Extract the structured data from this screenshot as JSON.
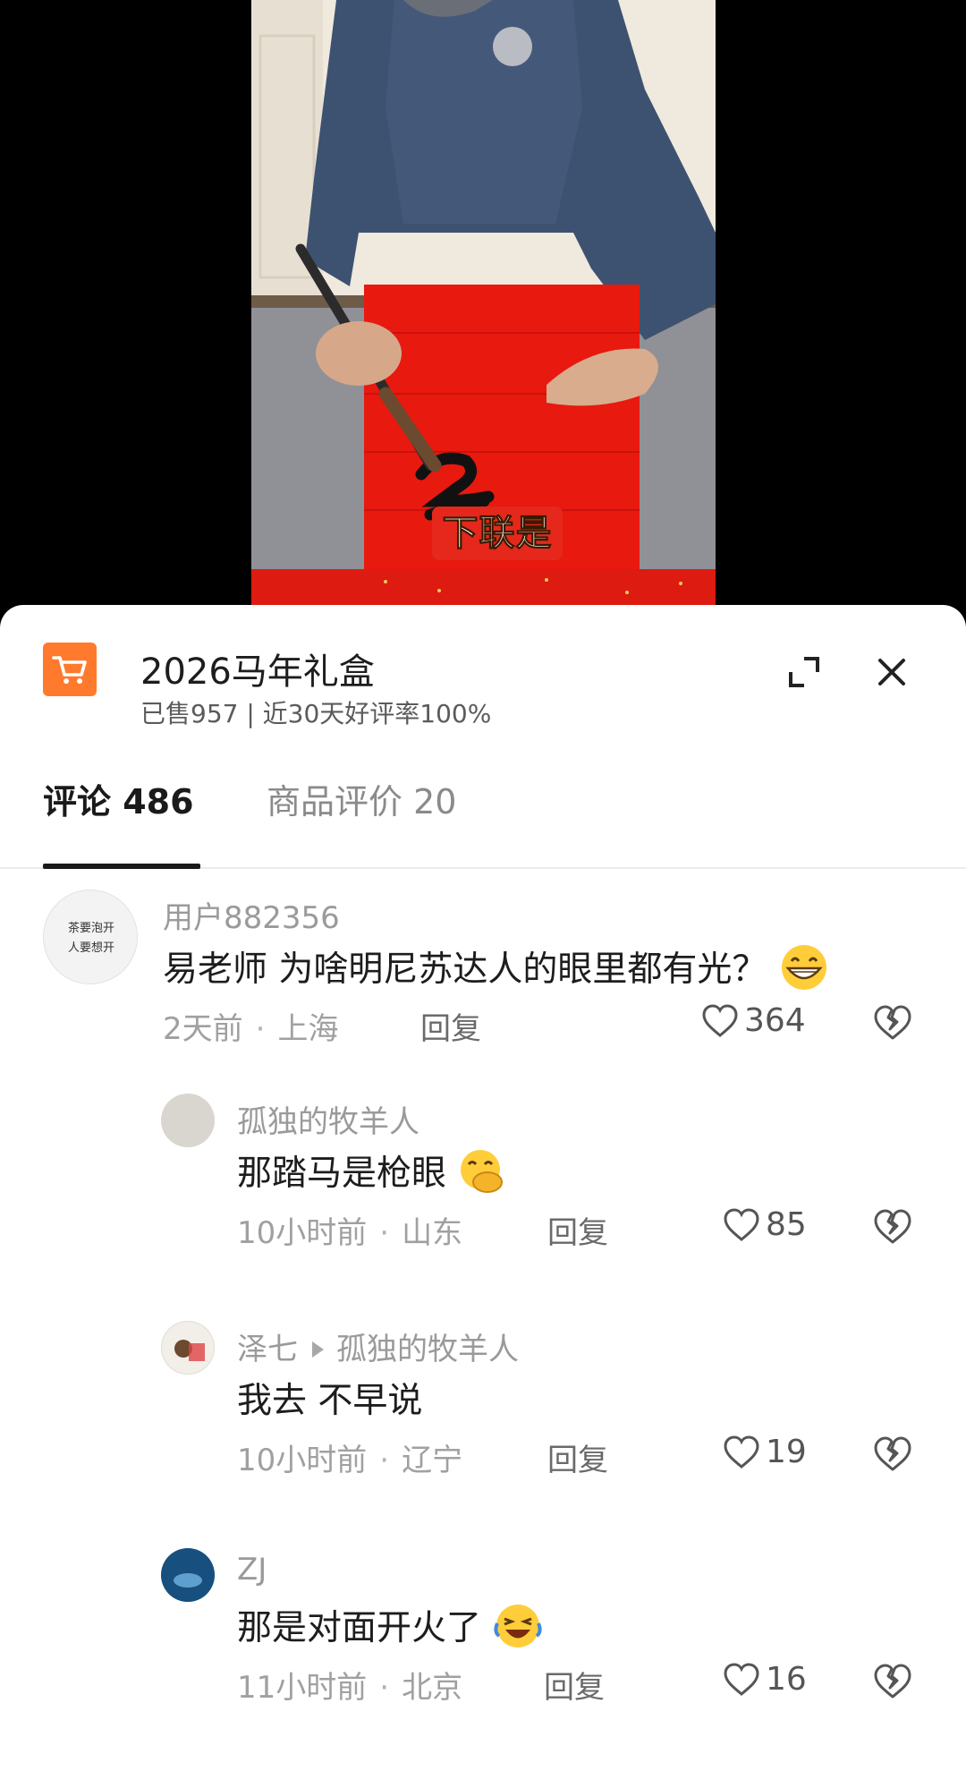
{
  "video": {
    "caption": "下联是"
  },
  "product": {
    "title": "2026马年礼盒",
    "subtitle": "已售957 | 近30天好评率100%",
    "icon": "shopping-cart-icon",
    "accent": "#ff7a2c"
  },
  "tabs": [
    {
      "label": "评论 486",
      "active": true
    },
    {
      "label": "商品评价 20",
      "active": false
    }
  ],
  "comments": [
    {
      "user": "用户882356",
      "avatar_text": [
        "茶要泡开",
        "人要想开"
      ],
      "text": "易老师 为啥明尼苏达人的眼里都有光？",
      "emoji": "grin-emoji",
      "time": "2天前",
      "location": "上海",
      "reply_label": "回复",
      "likes": "364"
    },
    {
      "user": "孤独的牧羊人",
      "text": "那踏马是枪眼",
      "emoji": "hand-over-mouth-emoji",
      "time": "10小时前",
      "location": "山东",
      "reply_label": "回复",
      "likes": "85"
    },
    {
      "user": "泽七",
      "reply_to": "孤独的牧羊人",
      "text": "我去 不早说",
      "time": "10小时前",
      "location": "辽宁",
      "reply_label": "回复",
      "likes": "19"
    },
    {
      "user": "ZJ",
      "text": "那是对面开火了",
      "emoji": "crying-laughing-emoji",
      "time": "11小时前",
      "location": "北京",
      "reply_label": "回复",
      "likes": "16"
    }
  ]
}
